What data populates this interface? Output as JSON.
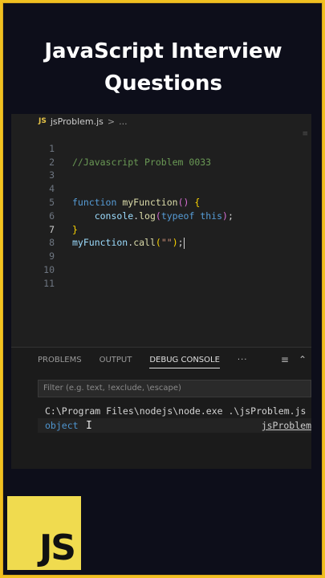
{
  "title": {
    "line1": "JavaScript Interview",
    "line2": "Questions"
  },
  "editor": {
    "tab_badge": "JS",
    "tab_file": "jsProblem.js",
    "tab_separator": ">",
    "tab_more": "...",
    "lines": [
      {
        "num": "1",
        "text": "//Javascript Problem 0033"
      },
      {
        "num": "2",
        "text": ""
      },
      {
        "num": "3",
        "text": ""
      },
      {
        "num": "4",
        "text": "function myFunction() {"
      },
      {
        "num": "5",
        "text": "    console.log(typeof this);"
      },
      {
        "num": "6",
        "text": "}"
      },
      {
        "num": "7",
        "text": "myFunction.call(\"\");"
      },
      {
        "num": "8",
        "text": ""
      },
      {
        "num": "9",
        "text": ""
      },
      {
        "num": "10",
        "text": ""
      },
      {
        "num": "11",
        "text": ""
      }
    ]
  },
  "panel": {
    "tabs": [
      "PROBLEMS",
      "OUTPUT",
      "DEBUG CONSOLE"
    ],
    "active_tab": "DEBUG CONSOLE",
    "more": "···",
    "filter_placeholder": "Filter (e.g. text, !exclude, \\escape)",
    "command_line": "C:\\Program Files\\nodejs\\node.exe .\\jsProblem.js",
    "output_value": "object",
    "output_source": "jsProblem"
  },
  "logo": {
    "text": "JS"
  },
  "colors": {
    "border": "#f0c020",
    "background": "#0d0e1a",
    "js_yellow": "#f0db4f"
  }
}
